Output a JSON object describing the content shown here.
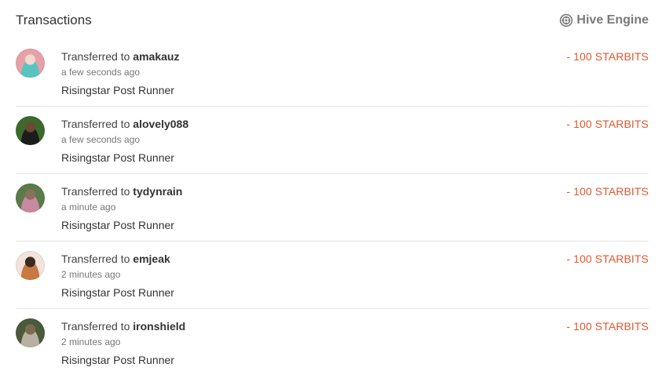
{
  "header": {
    "title": "Transactions",
    "engine_label": "Hive Engine",
    "engine_icon": "hive-engine-icon"
  },
  "colors": {
    "amount": "#e2572c",
    "divider": "#e3e3e3",
    "muted": "#777777"
  },
  "transactions": [
    {
      "action": "Transferred to",
      "user": "amakauz",
      "time": "a few seconds ago",
      "memo": "Risingstar Post Runner",
      "amount": "- 100 STARBITS",
      "avatar_colors": [
        "#e8a0a8",
        "#58c4c0",
        "#f2d8d0"
      ]
    },
    {
      "action": "Transferred to",
      "user": "alovely088",
      "time": "a few seconds ago",
      "memo": "Risingstar Post Runner",
      "amount": "- 100 STARBITS",
      "avatar_colors": [
        "#3c6a2c",
        "#1c1c1c",
        "#6a4a34"
      ]
    },
    {
      "action": "Transferred to",
      "user": "tydynrain",
      "time": "a minute ago",
      "memo": "Risingstar Post Runner",
      "amount": "- 100 STARBITS",
      "avatar_colors": [
        "#5c7a4a",
        "#c88aa0",
        "#8a7060"
      ]
    },
    {
      "action": "Transferred to",
      "user": "emjeak",
      "time": "2 minutes ago",
      "memo": "Risingstar Post Runner",
      "amount": "- 100 STARBITS",
      "avatar_colors": [
        "#f0e4dc",
        "#c87840",
        "#3a2a20"
      ]
    },
    {
      "action": "Transferred to",
      "user": "ironshield",
      "time": "2 minutes ago",
      "memo": "Risingstar Post Runner",
      "amount": "- 100 STARBITS",
      "avatar_colors": [
        "#4a5a3a",
        "#b8b0a0",
        "#7a6a50"
      ]
    }
  ]
}
